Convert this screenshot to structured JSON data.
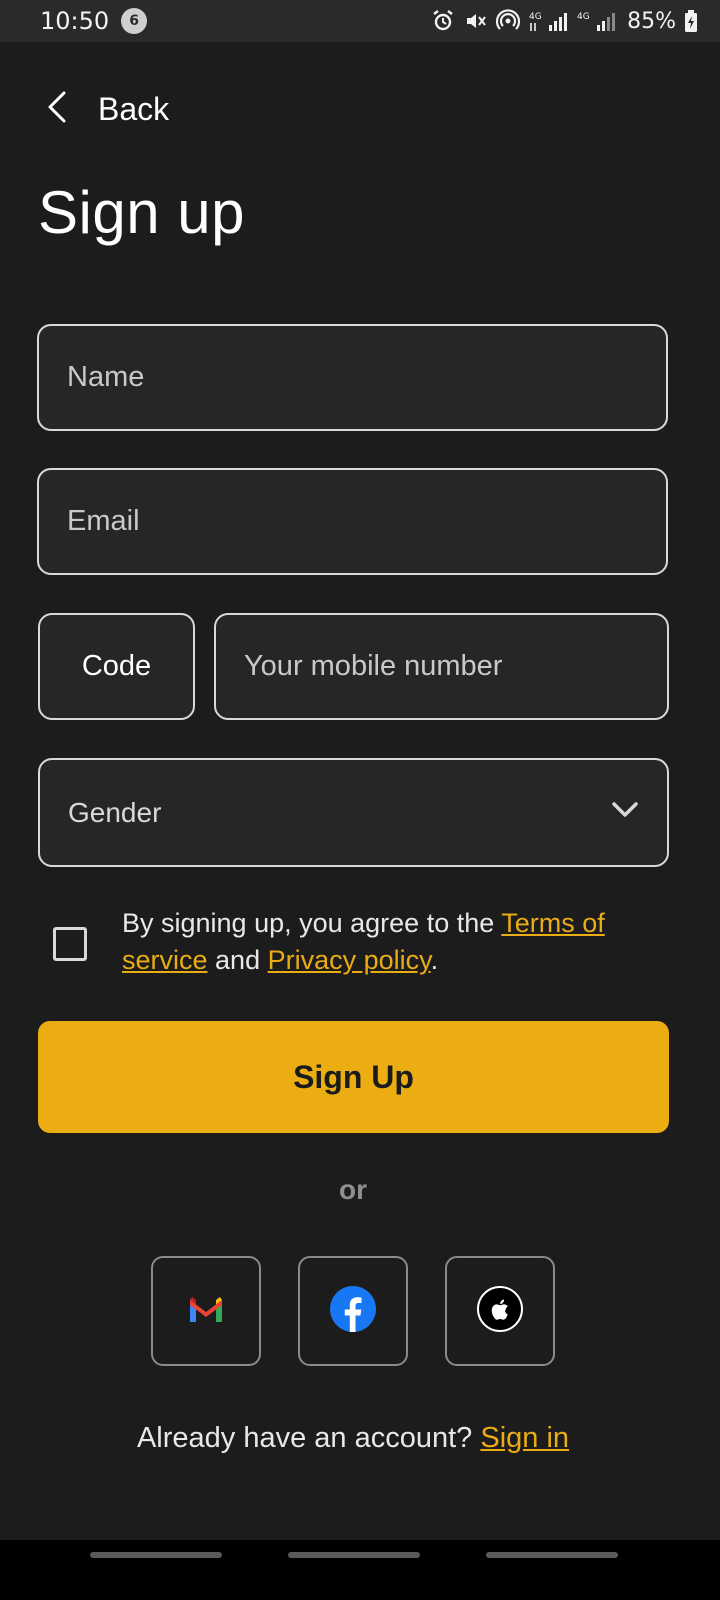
{
  "status_bar": {
    "time": "10:50",
    "notification_count": "6",
    "battery": "85%",
    "icons": [
      "alarm-icon",
      "mute-icon",
      "hotspot-icon",
      "4g-signal-icon",
      "4g-signal-icon",
      "battery-charging-icon"
    ]
  },
  "header": {
    "back_label": "Back",
    "title": "Sign up"
  },
  "form": {
    "name_placeholder": "Name",
    "email_placeholder": "Email",
    "code_label": "Code",
    "mobile_placeholder": "Your mobile number",
    "gender_label": "Gender"
  },
  "terms": {
    "prefix": "By signing up, you agree to the ",
    "terms_link": "Terms of service",
    "middle": " and ",
    "privacy_link": "Privacy policy",
    "suffix": ".",
    "checked": false
  },
  "actions": {
    "signup_label": "Sign Up",
    "or_label": "or"
  },
  "social": [
    "gmail",
    "facebook",
    "apple"
  ],
  "footer": {
    "prompt": "Already have an account? ",
    "signin_link": "Sign in"
  },
  "colors": {
    "background": "#1c1c1c",
    "accent": "#ebad11",
    "field_border": "#d9d9d9"
  }
}
